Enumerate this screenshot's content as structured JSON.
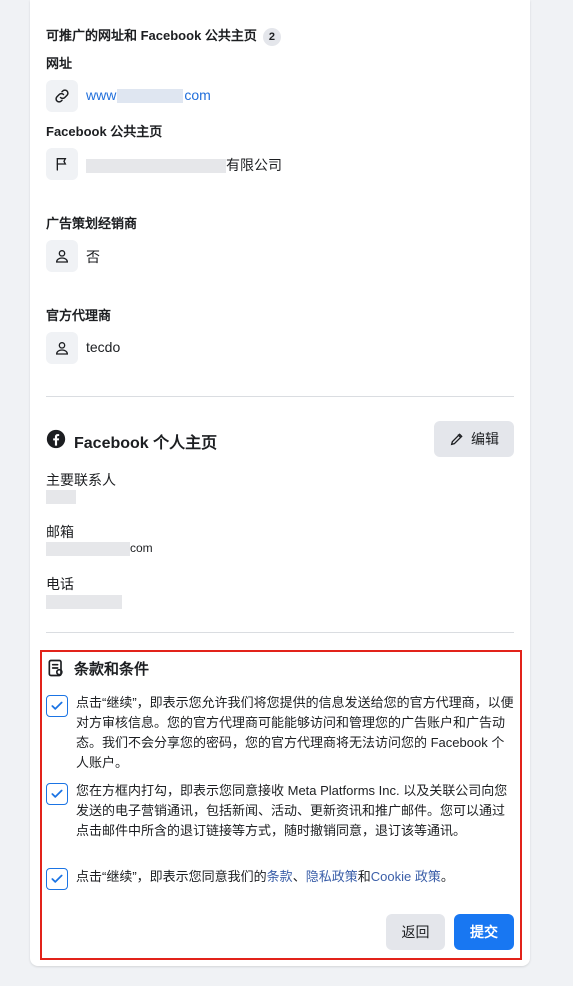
{
  "promotable": {
    "title": "可推广的网址和 Facebook 公共主页",
    "count": "2",
    "url_label": "网址",
    "url_prefix": "www",
    "url_suffix": "com",
    "page_label": "Facebook 公共主页",
    "page_suffix": "有限公司"
  },
  "agency": {
    "planner_label": "广告策划经销商",
    "planner_value": "否",
    "official_label": "官方代理商",
    "official_value": "tecdo"
  },
  "profile": {
    "title": "Facebook 个人主页",
    "edit_label": "编辑",
    "contact_label": "主要联系人",
    "email_label": "邮箱",
    "email_suffix": "com",
    "phone_label": "电话"
  },
  "terms": {
    "title": "条款和条件",
    "item1": "点击“继续”，即表示您允许我们将您提供的信息发送给您的官方代理商，以便对方审核信息。您的官方代理商可能能够访问和管理您的广告账户和广告动态。我们不会分享您的密码，您的官方代理商将无法访问您的 Facebook 个人账户。",
    "item2": "您在方框内打勾，即表示您同意接收 Meta Platforms Inc. 以及关联公司向您发送的电子营销通讯，包括新闻、活动、更新资讯和推广邮件。您可以通过点击邮件中所含的退订链接等方式，随时撤销同意，退订该等通讯。",
    "item3_prefix": "点击“继续”，即表示您同意我们的",
    "item3_link1": "条款",
    "item3_sep": "、",
    "item3_link2": "隐私政策",
    "item3_and": "和",
    "item3_link3": "Cookie 政策",
    "item3_end": "。"
  },
  "actions": {
    "back": "返回",
    "submit": "提交"
  },
  "colors": {
    "link": "#216fdb",
    "primary": "#1877f2",
    "highlight_border": "#e2231a"
  }
}
